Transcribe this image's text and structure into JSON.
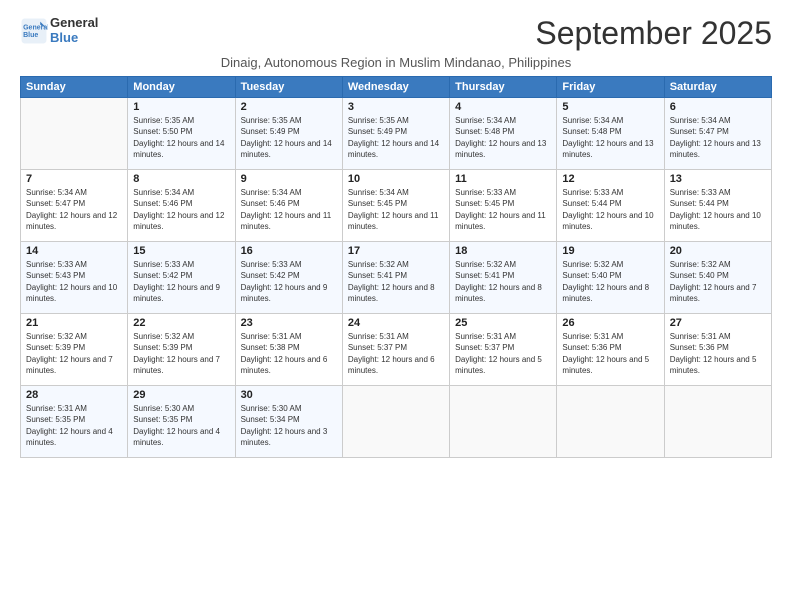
{
  "logo": {
    "line1": "General",
    "line2": "Blue"
  },
  "title": "September 2025",
  "subtitle": "Dinaig, Autonomous Region in Muslim Mindanao, Philippines",
  "days_header": [
    "Sunday",
    "Monday",
    "Tuesday",
    "Wednesday",
    "Thursday",
    "Friday",
    "Saturday"
  ],
  "weeks": [
    [
      {
        "day": "",
        "sunrise": "",
        "sunset": "",
        "daylight": ""
      },
      {
        "day": "1",
        "sunrise": "Sunrise: 5:35 AM",
        "sunset": "Sunset: 5:50 PM",
        "daylight": "Daylight: 12 hours and 14 minutes."
      },
      {
        "day": "2",
        "sunrise": "Sunrise: 5:35 AM",
        "sunset": "Sunset: 5:49 PM",
        "daylight": "Daylight: 12 hours and 14 minutes."
      },
      {
        "day": "3",
        "sunrise": "Sunrise: 5:35 AM",
        "sunset": "Sunset: 5:49 PM",
        "daylight": "Daylight: 12 hours and 14 minutes."
      },
      {
        "day": "4",
        "sunrise": "Sunrise: 5:34 AM",
        "sunset": "Sunset: 5:48 PM",
        "daylight": "Daylight: 12 hours and 13 minutes."
      },
      {
        "day": "5",
        "sunrise": "Sunrise: 5:34 AM",
        "sunset": "Sunset: 5:48 PM",
        "daylight": "Daylight: 12 hours and 13 minutes."
      },
      {
        "day": "6",
        "sunrise": "Sunrise: 5:34 AM",
        "sunset": "Sunset: 5:47 PM",
        "daylight": "Daylight: 12 hours and 13 minutes."
      }
    ],
    [
      {
        "day": "7",
        "sunrise": "Sunrise: 5:34 AM",
        "sunset": "Sunset: 5:47 PM",
        "daylight": "Daylight: 12 hours and 12 minutes."
      },
      {
        "day": "8",
        "sunrise": "Sunrise: 5:34 AM",
        "sunset": "Sunset: 5:46 PM",
        "daylight": "Daylight: 12 hours and 12 minutes."
      },
      {
        "day": "9",
        "sunrise": "Sunrise: 5:34 AM",
        "sunset": "Sunset: 5:46 PM",
        "daylight": "Daylight: 12 hours and 11 minutes."
      },
      {
        "day": "10",
        "sunrise": "Sunrise: 5:34 AM",
        "sunset": "Sunset: 5:45 PM",
        "daylight": "Daylight: 12 hours and 11 minutes."
      },
      {
        "day": "11",
        "sunrise": "Sunrise: 5:33 AM",
        "sunset": "Sunset: 5:45 PM",
        "daylight": "Daylight: 12 hours and 11 minutes."
      },
      {
        "day": "12",
        "sunrise": "Sunrise: 5:33 AM",
        "sunset": "Sunset: 5:44 PM",
        "daylight": "Daylight: 12 hours and 10 minutes."
      },
      {
        "day": "13",
        "sunrise": "Sunrise: 5:33 AM",
        "sunset": "Sunset: 5:44 PM",
        "daylight": "Daylight: 12 hours and 10 minutes."
      }
    ],
    [
      {
        "day": "14",
        "sunrise": "Sunrise: 5:33 AM",
        "sunset": "Sunset: 5:43 PM",
        "daylight": "Daylight: 12 hours and 10 minutes."
      },
      {
        "day": "15",
        "sunrise": "Sunrise: 5:33 AM",
        "sunset": "Sunset: 5:42 PM",
        "daylight": "Daylight: 12 hours and 9 minutes."
      },
      {
        "day": "16",
        "sunrise": "Sunrise: 5:33 AM",
        "sunset": "Sunset: 5:42 PM",
        "daylight": "Daylight: 12 hours and 9 minutes."
      },
      {
        "day": "17",
        "sunrise": "Sunrise: 5:32 AM",
        "sunset": "Sunset: 5:41 PM",
        "daylight": "Daylight: 12 hours and 8 minutes."
      },
      {
        "day": "18",
        "sunrise": "Sunrise: 5:32 AM",
        "sunset": "Sunset: 5:41 PM",
        "daylight": "Daylight: 12 hours and 8 minutes."
      },
      {
        "day": "19",
        "sunrise": "Sunrise: 5:32 AM",
        "sunset": "Sunset: 5:40 PM",
        "daylight": "Daylight: 12 hours and 8 minutes."
      },
      {
        "day": "20",
        "sunrise": "Sunrise: 5:32 AM",
        "sunset": "Sunset: 5:40 PM",
        "daylight": "Daylight: 12 hours and 7 minutes."
      }
    ],
    [
      {
        "day": "21",
        "sunrise": "Sunrise: 5:32 AM",
        "sunset": "Sunset: 5:39 PM",
        "daylight": "Daylight: 12 hours and 7 minutes."
      },
      {
        "day": "22",
        "sunrise": "Sunrise: 5:32 AM",
        "sunset": "Sunset: 5:39 PM",
        "daylight": "Daylight: 12 hours and 7 minutes."
      },
      {
        "day": "23",
        "sunrise": "Sunrise: 5:31 AM",
        "sunset": "Sunset: 5:38 PM",
        "daylight": "Daylight: 12 hours and 6 minutes."
      },
      {
        "day": "24",
        "sunrise": "Sunrise: 5:31 AM",
        "sunset": "Sunset: 5:37 PM",
        "daylight": "Daylight: 12 hours and 6 minutes."
      },
      {
        "day": "25",
        "sunrise": "Sunrise: 5:31 AM",
        "sunset": "Sunset: 5:37 PM",
        "daylight": "Daylight: 12 hours and 5 minutes."
      },
      {
        "day": "26",
        "sunrise": "Sunrise: 5:31 AM",
        "sunset": "Sunset: 5:36 PM",
        "daylight": "Daylight: 12 hours and 5 minutes."
      },
      {
        "day": "27",
        "sunrise": "Sunrise: 5:31 AM",
        "sunset": "Sunset: 5:36 PM",
        "daylight": "Daylight: 12 hours and 5 minutes."
      }
    ],
    [
      {
        "day": "28",
        "sunrise": "Sunrise: 5:31 AM",
        "sunset": "Sunset: 5:35 PM",
        "daylight": "Daylight: 12 hours and 4 minutes."
      },
      {
        "day": "29",
        "sunrise": "Sunrise: 5:30 AM",
        "sunset": "Sunset: 5:35 PM",
        "daylight": "Daylight: 12 hours and 4 minutes."
      },
      {
        "day": "30",
        "sunrise": "Sunrise: 5:30 AM",
        "sunset": "Sunset: 5:34 PM",
        "daylight": "Daylight: 12 hours and 3 minutes."
      },
      {
        "day": "",
        "sunrise": "",
        "sunset": "",
        "daylight": ""
      },
      {
        "day": "",
        "sunrise": "",
        "sunset": "",
        "daylight": ""
      },
      {
        "day": "",
        "sunrise": "",
        "sunset": "",
        "daylight": ""
      },
      {
        "day": "",
        "sunrise": "",
        "sunset": "",
        "daylight": ""
      }
    ]
  ]
}
